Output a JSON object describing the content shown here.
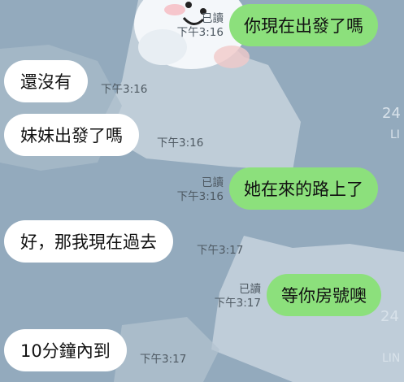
{
  "messages": [
    {
      "side": "out",
      "text": "你現在出發了嗎",
      "read": "已讀",
      "time": "下午3:16"
    },
    {
      "side": "in",
      "text": "還沒有",
      "time": "下午3:16"
    },
    {
      "side": "in",
      "text": "妹妹出發了嗎",
      "time": "下午3:16"
    },
    {
      "side": "out",
      "text": "她在來的路上了",
      "read": "已讀",
      "time": "下午3:16"
    },
    {
      "side": "in",
      "text": "好，那我現在過去",
      "time": "下午3:17"
    },
    {
      "side": "out",
      "text": "等你房號噢",
      "read": "已讀",
      "time": "下午3:17"
    },
    {
      "side": "in",
      "text": "10分鐘內到",
      "time": "下午3:17"
    }
  ],
  "colors": {
    "chat_background": "#93aabd",
    "outgoing_bubble": "#8ce07c",
    "incoming_bubble": "#ffffff"
  }
}
